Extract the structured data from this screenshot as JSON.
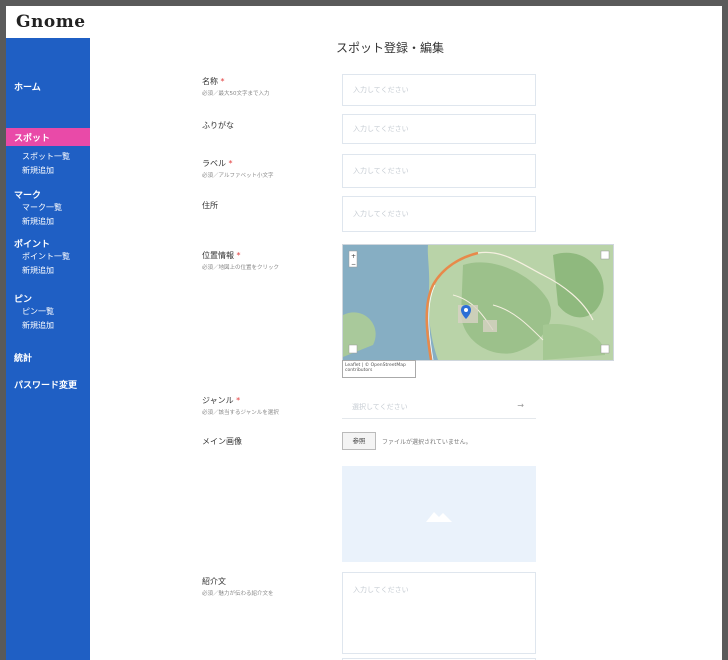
{
  "app": {
    "logo": "Gnome",
    "logo_sub": ""
  },
  "sidebar": {
    "home": "ホーム",
    "spot": "スポット",
    "spot_list": "スポット一覧",
    "spot_new": "新規追加",
    "mark": "マーク",
    "mark_list": "マーク一覧",
    "mark_new": "新規追加",
    "point": "ポイント",
    "point_list": "ポイント一覧",
    "point_new": "新規追加",
    "pin": "ピン",
    "pin_list": "ピン一覧",
    "pin_new": "新規追加",
    "stats": "統計",
    "password": "パスワード変更"
  },
  "page": {
    "title": "スポット登録・編集"
  },
  "form": {
    "name_label": "名称",
    "name_hint": "必須／最大50文字まで入力",
    "name_placeholder": "入力してください",
    "furigana_label": "ふりがな",
    "furigana_placeholder": "入力してください",
    "label_label": "ラベル",
    "label_hint": "必須／アルファベット小文字",
    "label_placeholder": "入力してください",
    "address_label": "住所",
    "address_placeholder": "入力してください",
    "location_label": "位置情報",
    "location_hint": "必須／地図上の位置をクリック",
    "map_attribution": "Leaflet | © OpenStreetMap contributors",
    "genre_label": "ジャンル",
    "genre_hint": "必須／該当するジャンルを選択",
    "genre_placeholder": "選択してください",
    "genre_arrow": "→",
    "main_image_label": "メイン画像",
    "file_button": "参照",
    "file_status": "ファイルが選択されていません。",
    "intro_label": "紹介文",
    "intro_hint": "必須／魅力が伝わる紹介文を",
    "intro_placeholder": "入力してください",
    "required_mark": "*"
  }
}
